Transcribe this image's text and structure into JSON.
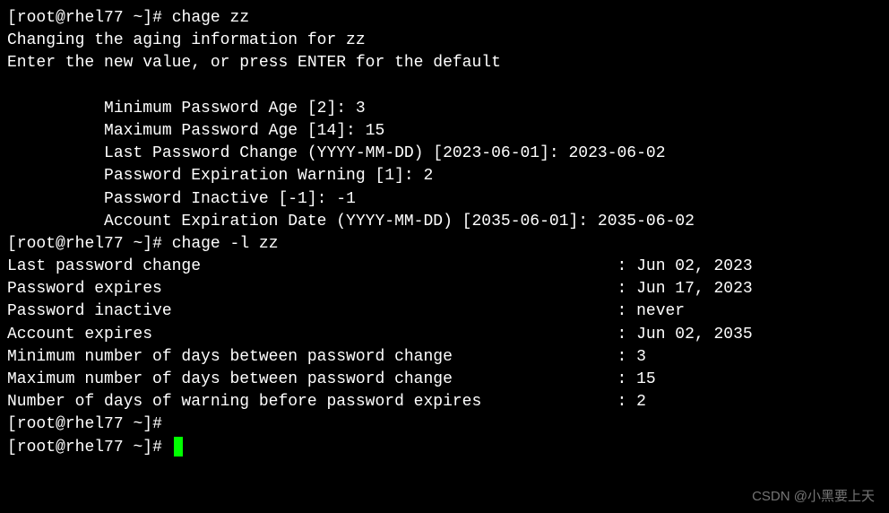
{
  "prompt": {
    "user": "root",
    "host": "rhel77",
    "path": "~",
    "symbol": "#"
  },
  "cmd1": "chage zz",
  "changing_line": "Changing the aging information for zz",
  "enter_line": "Enter the new value, or press ENTER for the default",
  "fields": {
    "min_age_label": "Minimum Password Age [2]: ",
    "min_age_val": "3",
    "max_age_label": "Maximum Password Age [14]: ",
    "max_age_val": "15",
    "last_change_label": "Last Password Change (YYYY-MM-DD) [2023-06-01]: ",
    "last_change_val": "2023-06-02",
    "warn_label": "Password Expiration Warning [1]: ",
    "warn_val": "2",
    "inactive_label": "Password Inactive [-1]: ",
    "inactive_val": "-1",
    "acct_exp_label": "Account Expiration Date (YYYY-MM-DD) [2035-06-01]: ",
    "acct_exp_val": "2035-06-02"
  },
  "cmd2": "chage -l zz",
  "info": {
    "last_change_l": "Last password change",
    "last_change_v": "Jun 02, 2023",
    "pw_expires_l": "Password expires",
    "pw_expires_v": "Jun 17, 2023",
    "pw_inactive_l": "Password inactive",
    "pw_inactive_v": "never",
    "acct_expires_l": "Account expires",
    "acct_expires_v": "Jun 02, 2035",
    "min_days_l": "Minimum number of days between password change",
    "min_days_v": "3",
    "max_days_l": "Maximum number of days between password change",
    "max_days_v": "15",
    "warn_days_l": "Number of days of warning before password expires",
    "warn_days_v": "2"
  },
  "sep": ": ",
  "watermark": "CSDN @小黑要上天"
}
